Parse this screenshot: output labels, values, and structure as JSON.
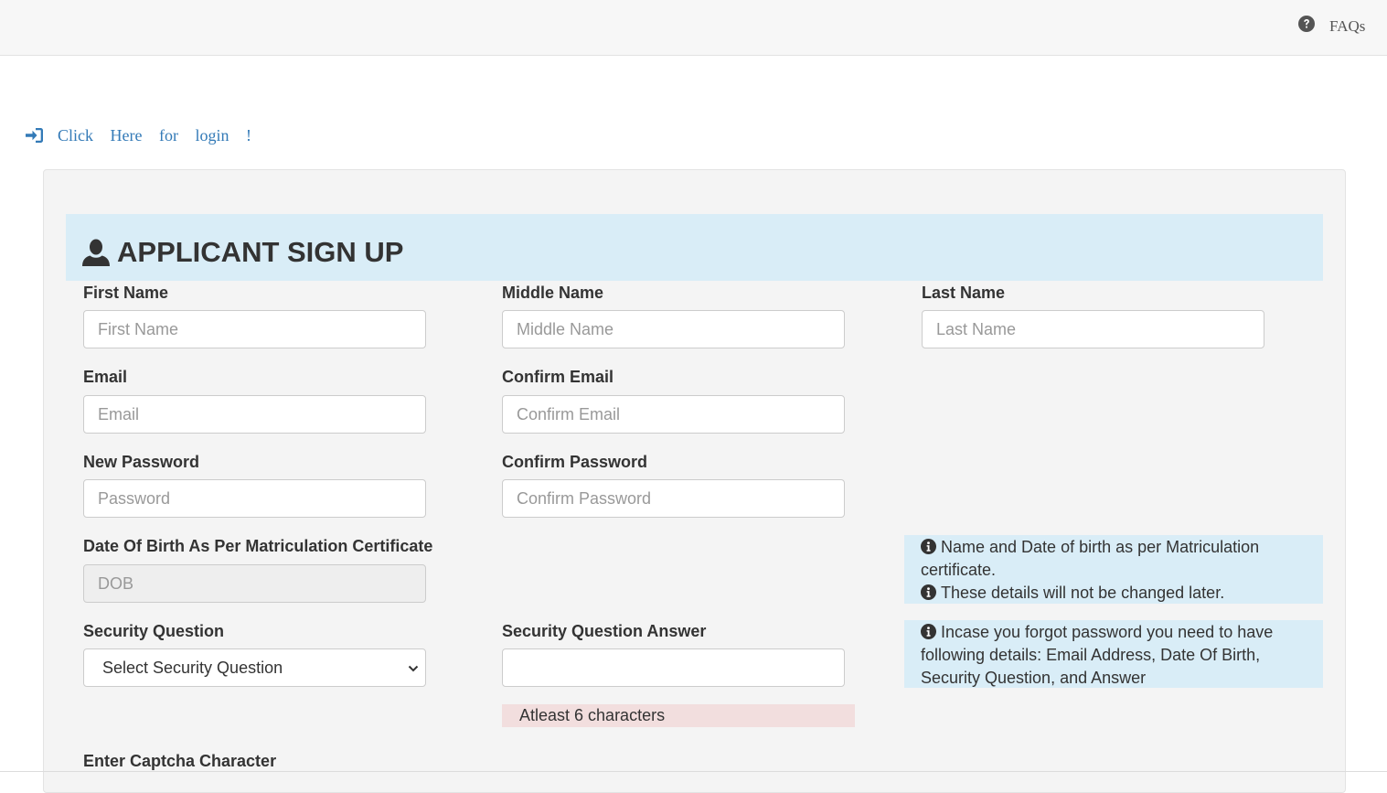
{
  "header": {
    "faq_label": "FAQs"
  },
  "login_link": {
    "text": "Click Here for login !"
  },
  "form": {
    "title": "APPLICANT SIGN UP",
    "first_name": {
      "label": "First Name",
      "placeholder": "First Name"
    },
    "middle_name": {
      "label": "Middle Name",
      "placeholder": "Middle Name"
    },
    "last_name": {
      "label": "Last Name",
      "placeholder": "Last Name"
    },
    "email": {
      "label": "Email",
      "placeholder": "Email"
    },
    "confirm_email": {
      "label": "Confirm Email",
      "placeholder": "Confirm Email"
    },
    "new_password": {
      "label": "New Password",
      "placeholder": "Password"
    },
    "confirm_password": {
      "label": "Confirm Password",
      "placeholder": "Confirm Password"
    },
    "dob": {
      "label": "Date Of Birth As Per Matriculation Certificate",
      "placeholder": "DOB"
    },
    "security_question": {
      "label": "Security Question",
      "selected": "Select Security Question"
    },
    "security_answer": {
      "label": "Security Question Answer",
      "value": "",
      "hint": "Atleast 6 characters"
    },
    "captcha": {
      "label": "Enter Captcha Character"
    }
  },
  "info": {
    "dob_note_1": "Name and Date of birth as per Matriculation certificate.",
    "dob_note_2": "These details will not be changed later.",
    "password_note": "Incase you forgot password you need to have following details: Email Address, Date Of Birth, Security Question, and Answer"
  },
  "colors": {
    "link": "#337ab7",
    "heading_bg": "#d9edf7",
    "hint_bg": "#f2dede",
    "panel_bg": "#f4f4f4"
  },
  "icons": {
    "faq": "question-circle-icon",
    "login": "sign-in-icon",
    "heading": "user-icon",
    "info": "info-circle-icon",
    "select": "chevron-down-icon"
  }
}
